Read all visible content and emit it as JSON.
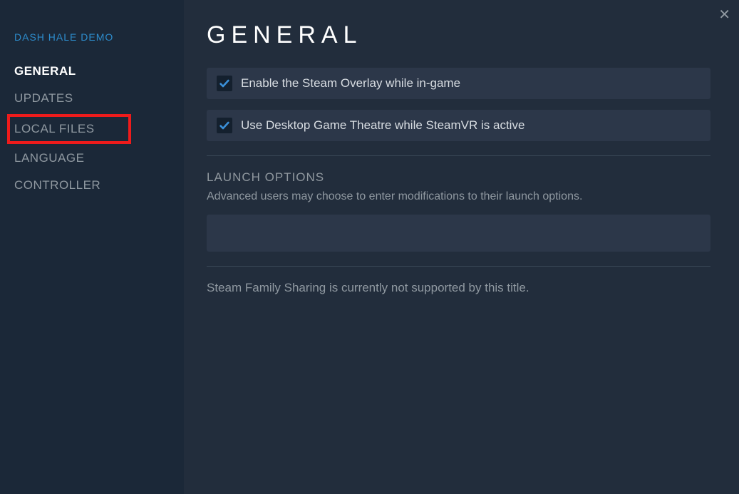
{
  "sidebar": {
    "game_title": "DASH HALE DEMO",
    "nav": {
      "general": "GENERAL",
      "updates": "UPDATES",
      "local_files": "LOCAL FILES",
      "language": "LANGUAGE",
      "controller": "CONTROLLER"
    }
  },
  "content": {
    "title": "GENERAL",
    "options": {
      "overlay": {
        "checked": true,
        "label": "Enable the Steam Overlay while in-game"
      },
      "desktop_theatre": {
        "checked": true,
        "label": "Use Desktop Game Theatre while SteamVR is active"
      }
    },
    "launch_options": {
      "heading": "LAUNCH OPTIONS",
      "description": "Advanced users may choose to enter modifications to their launch options.",
      "value": ""
    },
    "family_sharing_note": "Steam Family Sharing is currently not supported by this title."
  }
}
